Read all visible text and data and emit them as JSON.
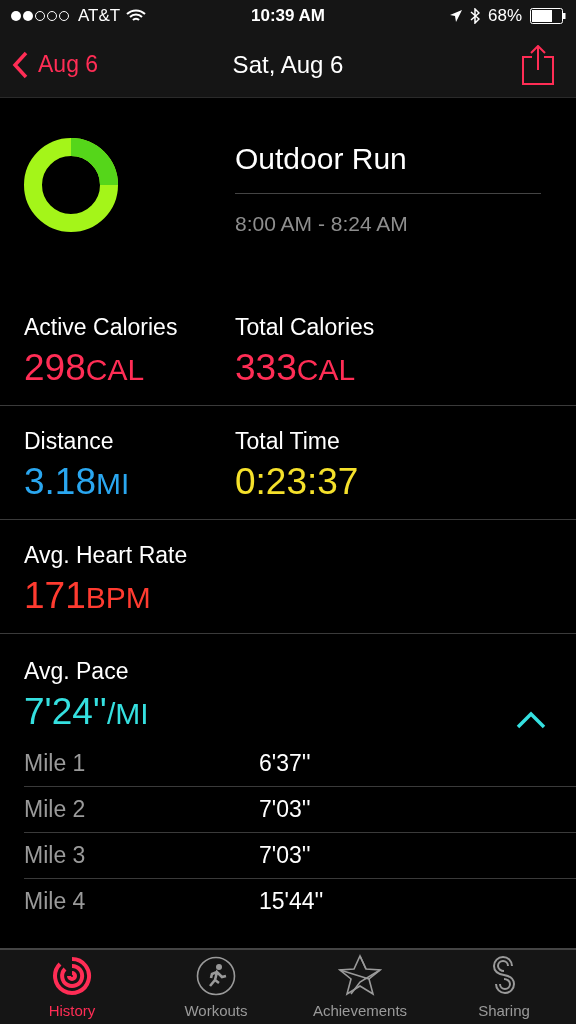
{
  "status_bar": {
    "carrier": "AT&T",
    "time": "10:39 AM",
    "battery": "68%"
  },
  "nav": {
    "back": "Aug 6",
    "title": "Sat, Aug 6"
  },
  "workout": {
    "title": "Outdoor Run",
    "time_range": "8:00 AM - 8:24 AM"
  },
  "metric_rows": [
    {
      "metrics": [
        {
          "label": "Active Calories",
          "value": "298",
          "unit": "CAL",
          "color": "#ff2d55"
        },
        {
          "label": "Total Calories",
          "value": "333",
          "unit": "CAL",
          "color": "#ff2d55"
        }
      ]
    },
    {
      "metrics": [
        {
          "label": "Distance",
          "value": "3.18",
          "unit": "MI",
          "color": "#2aa7f0"
        },
        {
          "label": "Total Time",
          "value": "0:23:37",
          "color": "#f5e12b"
        }
      ]
    },
    {
      "metrics": [
        {
          "label": "Avg. Heart Rate",
          "value": "171",
          "unit": "BPM",
          "color": "#ff3b30"
        }
      ]
    }
  ],
  "pace": {
    "label": "Avg. Pace",
    "value": "7'24''",
    "unit": "/MI",
    "color": "#35e0e0",
    "expanded": true,
    "splits": [
      {
        "label": "Mile 1",
        "value": "6'37''"
      },
      {
        "label": "Mile 2",
        "value": "7'03''"
      },
      {
        "label": "Mile 3",
        "value": "7'03''"
      },
      {
        "label": "Mile 4",
        "value": "15'44''"
      }
    ]
  },
  "tabs": [
    {
      "label": "History",
      "selected": true
    },
    {
      "label": "Workouts",
      "selected": false
    },
    {
      "label": "Achievements",
      "selected": false
    },
    {
      "label": "Sharing",
      "selected": false
    }
  ]
}
